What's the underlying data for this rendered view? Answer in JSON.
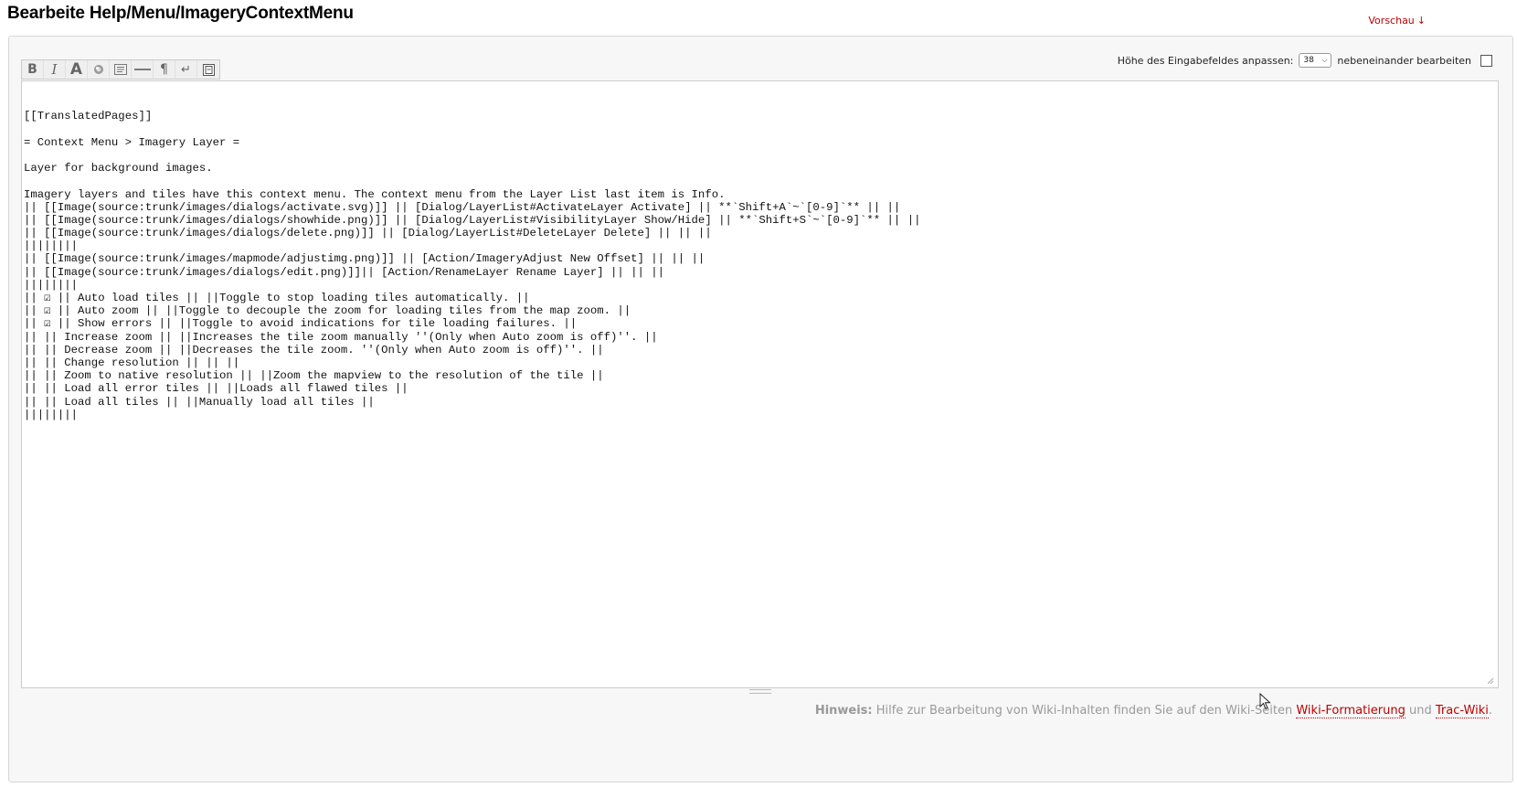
{
  "header": {
    "title": "Bearbeite Help/Menu/ImageryContextMenu",
    "preview_label": "Vorschau",
    "preview_arrow": "↓"
  },
  "options": {
    "height_label": "Höhe des Eingabefeldes anpassen:",
    "height_value": "38",
    "side_by_side_label": "nebeneinander bearbeiten"
  },
  "toolbar": {
    "items": [
      {
        "icon": "bold-icon",
        "label": "B"
      },
      {
        "icon": "italic-icon",
        "label": "I"
      },
      {
        "icon": "heading-icon",
        "label": "A"
      },
      {
        "icon": "link-icon"
      },
      {
        "icon": "code-block-icon"
      },
      {
        "icon": "horizontal-rule-icon"
      },
      {
        "icon": "paragraph-icon",
        "label": "¶"
      },
      {
        "icon": "line-break-icon",
        "label": "↵"
      },
      {
        "icon": "image-icon"
      }
    ]
  },
  "editor": {
    "lines": [
      "[[TranslatedPages]]",
      "",
      "= Context Menu > Imagery Layer =",
      "",
      "Layer for background images.",
      "",
      "Imagery layers and tiles have this context menu. The context menu from the Layer List last item is Info.",
      "|| [[Image(source:trunk/images/dialogs/activate.svg)]] || [Dialog/LayerList#ActivateLayer Activate] || **`Shift+A`~`[0-9]`** || ||",
      "|| [[Image(source:trunk/images/dialogs/showhide.png)]] || [Dialog/LayerList#VisibilityLayer Show/Hide] || **`Shift+S`~`[0-9]`** || ||",
      "|| [[Image(source:trunk/images/dialogs/delete.png)]] || [Dialog/LayerList#DeleteLayer Delete] || || ||",
      "||||||||",
      "|| [[Image(source:trunk/images/mapmode/adjustimg.png)]] || [Action/ImageryAdjust New Offset] || || ||",
      "|| [[Image(source:trunk/images/dialogs/edit.png)]]|| [Action/RenameLayer Rename Layer] || || ||",
      "||||||||",
      "|| ☑ || Auto load tiles || ||Toggle to stop loading tiles automatically. ||",
      "|| ☑ || Auto zoom || ||Toggle to decouple the zoom for loading tiles from the map zoom. ||",
      "|| ☑ || Show errors || ||Toggle to avoid indications for tile loading failures. ||",
      "|| || Increase zoom || ||Increases the tile zoom manually ''(Only when Auto zoom is off)''. ||",
      "|| || Decrease zoom || ||Decreases the tile zoom. ''(Only when Auto zoom is off)''. ||",
      "|| || Change resolution || || ||",
      "|| || Zoom to native resolution || ||Zoom the mapview to the resolution of the tile ||",
      "|| || Load all error tiles || ||Loads all flawed tiles ||",
      "|| || Load all tiles || ||Manually load all tiles ||",
      "||||||||"
    ]
  },
  "hint": {
    "label": "Hinweis:",
    "text": " Hilfe zur Bearbeitung von Wiki-Inhalten finden Sie auf den Wiki-Seiten ",
    "link1": "Wiki-Formatierung",
    "between": " und ",
    "link2": "Trac-Wiki",
    "end": "."
  }
}
